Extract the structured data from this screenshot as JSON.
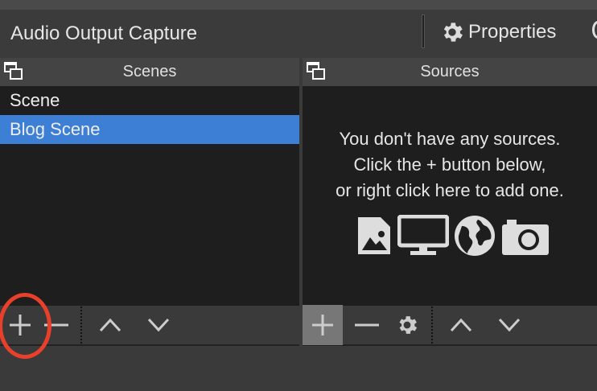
{
  "toolbar": {
    "source_name": "Audio Output Capture",
    "properties_label": "Properties"
  },
  "scenes": {
    "title": "Scenes",
    "items": [
      {
        "label": "Scene",
        "selected": false
      },
      {
        "label": "Blog Scene",
        "selected": true
      }
    ]
  },
  "sources": {
    "title": "Sources",
    "empty_lines": [
      "You don't have any sources.",
      "Click the + button below,",
      "or right click here to add one."
    ]
  },
  "colors": {
    "selection": "#3d7fd4",
    "highlight": "#e8402a"
  }
}
